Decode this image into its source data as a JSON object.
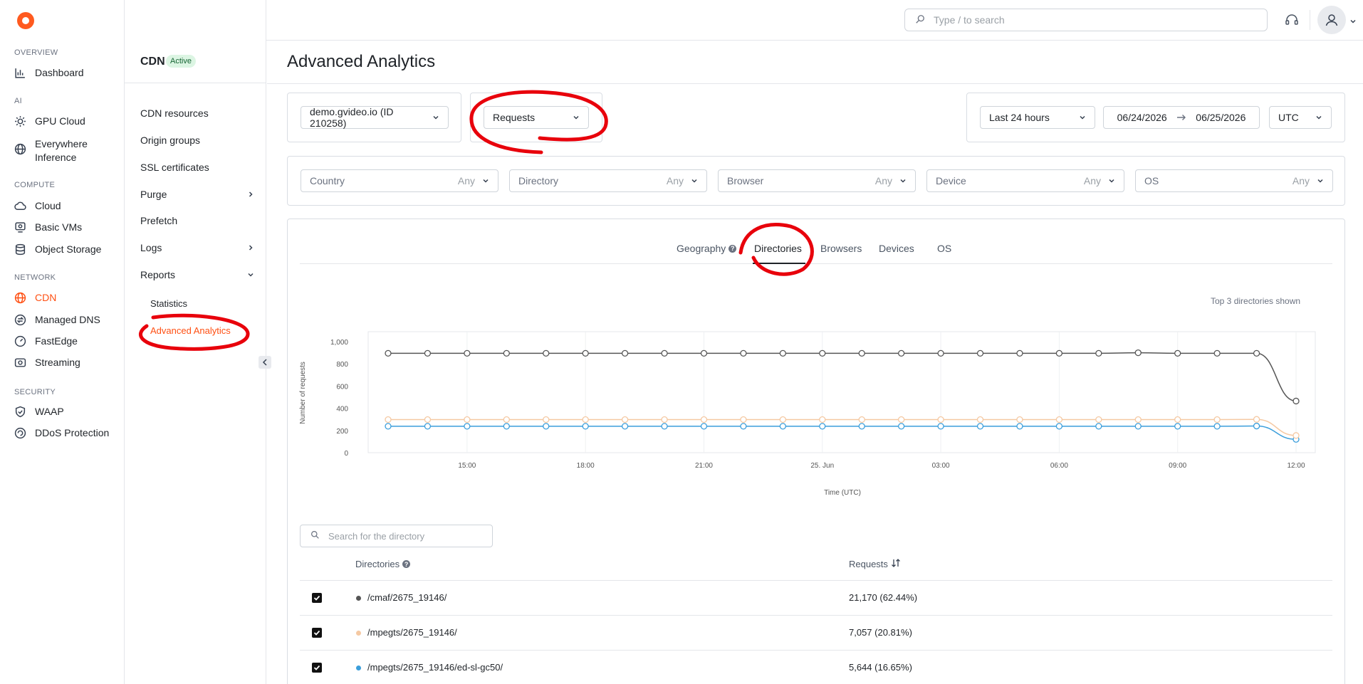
{
  "sidebar": {
    "sections": [
      {
        "label": "OVERVIEW",
        "items": [
          {
            "label": "Dashboard",
            "icon": "bar-chart-icon"
          }
        ]
      },
      {
        "label": "AI",
        "items": [
          {
            "label": "GPU Cloud",
            "icon": "gpu-icon"
          },
          {
            "label": "Everywhere Inference",
            "icon": "globe-icon"
          }
        ]
      },
      {
        "label": "COMPUTE",
        "items": [
          {
            "label": "Cloud",
            "icon": "cloud-icon"
          },
          {
            "label": "Basic VMs",
            "icon": "vm-icon"
          },
          {
            "label": "Object Storage",
            "icon": "database-icon"
          }
        ]
      },
      {
        "label": "NETWORK",
        "items": [
          {
            "label": "CDN",
            "icon": "globe-icon",
            "active": true
          },
          {
            "label": "Managed DNS",
            "icon": "dns-icon"
          },
          {
            "label": "FastEdge",
            "icon": "gauge-icon"
          },
          {
            "label": "Streaming",
            "icon": "stream-icon"
          }
        ]
      },
      {
        "label": "SECURITY",
        "items": [
          {
            "label": "WAAP",
            "icon": "shield-icon"
          },
          {
            "label": "DDoS Protection",
            "icon": "ddos-icon"
          }
        ]
      }
    ]
  },
  "product": {
    "title": "CDN",
    "status": "Active"
  },
  "subnav": {
    "items": [
      "CDN resources",
      "Origin groups",
      "SSL certificates",
      "Purge",
      "Prefetch",
      "Logs",
      "Reports",
      "Statistics",
      "Advanced Analytics"
    ]
  },
  "topbar": {
    "search_placeholder": "Type / to search"
  },
  "page": {
    "title": "Advanced Analytics"
  },
  "filters": {
    "resource": "demo.gvideo.io (ID 210258)",
    "metric": "Requests",
    "period": "Last 24 hours",
    "date_from": "06/24/2026",
    "date_to": "06/25/2026",
    "timezone": "UTC",
    "country": "Country",
    "directory": "Directory",
    "browser": "Browser",
    "device": "Device",
    "os": "OS",
    "any": "Any"
  },
  "tabs": [
    "Geography",
    "Directories",
    "Browsers",
    "Devices",
    "OS"
  ],
  "active_tab": "Directories",
  "top_note": "Top 3 directories shown",
  "chart_data": {
    "type": "line",
    "xlabel": "Time (UTC)",
    "ylabel": "Number of requests",
    "ylim": [
      0,
      1000
    ],
    "yticks": [
      "1,000",
      "800",
      "600",
      "400",
      "200",
      "0"
    ],
    "xticks": [
      "15:00",
      "18:00",
      "21:00",
      "25. Jun",
      "03:00",
      "06:00",
      "09:00",
      "12:00"
    ],
    "x": [
      "13:00",
      "14:00",
      "15:00",
      "16:00",
      "17:00",
      "18:00",
      "19:00",
      "20:00",
      "21:00",
      "22:00",
      "23:00",
      "00:00",
      "01:00",
      "02:00",
      "03:00",
      "04:00",
      "05:00",
      "06:00",
      "07:00",
      "08:00",
      "09:00",
      "10:00",
      "11:00",
      "12:00"
    ],
    "series": [
      {
        "name": "/cmaf/2675_19146/",
        "color": "#555555",
        "values": [
          895,
          895,
          895,
          895,
          895,
          895,
          895,
          895,
          895,
          895,
          895,
          895,
          895,
          895,
          895,
          895,
          895,
          895,
          895,
          900,
          895,
          895,
          895,
          465
        ]
      },
      {
        "name": "/mpegts/2675_19146/",
        "color": "#f5c9a3",
        "values": [
          298,
          298,
          298,
          298,
          298,
          298,
          298,
          298,
          298,
          298,
          298,
          298,
          298,
          298,
          298,
          298,
          298,
          298,
          298,
          298,
          298,
          298,
          300,
          155
        ]
      },
      {
        "name": "/mpegts/2675_19146/ed-sl-gc50/",
        "color": "#3b9edb",
        "values": [
          238,
          238,
          238,
          238,
          238,
          238,
          238,
          238,
          238,
          238,
          238,
          238,
          238,
          238,
          238,
          238,
          238,
          238,
          238,
          238,
          238,
          238,
          240,
          120
        ]
      }
    ]
  },
  "directory_search_placeholder": "Search for the directory",
  "table": {
    "headers": [
      "Directories",
      "Requests"
    ],
    "rows": [
      {
        "name": "/cmaf/2675_19146/",
        "requests": "21,170 (62.44%)",
        "color": "#555555",
        "checked": true
      },
      {
        "name": "/mpegts/2675_19146/",
        "requests": "7,057 (20.81%)",
        "color": "#f5c9a3",
        "checked": true
      },
      {
        "name": "/mpegts/2675_19146/ed-sl-gc50/",
        "requests": "5,644 (16.65%)",
        "color": "#3b9edb",
        "checked": true
      }
    ]
  },
  "colors": {
    "accent": "#ff4f12",
    "annotation": "#e8000b"
  }
}
